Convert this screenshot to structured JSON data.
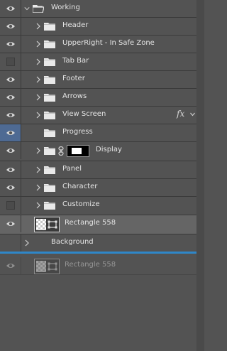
{
  "layers": [
    {
      "id": "working",
      "label": "Working",
      "visible": true,
      "kind": "group",
      "expanded": true,
      "indent": 0
    },
    {
      "id": "header",
      "label": "Header",
      "visible": true,
      "kind": "group",
      "indent": 1
    },
    {
      "id": "upperright",
      "label": "UpperRight - In Safe Zone",
      "visible": true,
      "kind": "group",
      "indent": 1
    },
    {
      "id": "tabbar",
      "label": "Tab Bar",
      "visible": false,
      "kind": "group",
      "indent": 1
    },
    {
      "id": "footer",
      "label": "Footer",
      "visible": true,
      "kind": "group",
      "indent": 1
    },
    {
      "id": "arrows",
      "label": "Arrows",
      "visible": true,
      "kind": "group",
      "indent": 1
    },
    {
      "id": "viewscreen",
      "label": "View Screen",
      "visible": true,
      "kind": "group",
      "indent": 1,
      "fx": "fx"
    },
    {
      "id": "progress",
      "label": "Progress",
      "visible": true,
      "kind": "group",
      "indent": 1,
      "nochevron": true,
      "highlight": true
    },
    {
      "id": "display",
      "label": "Display",
      "visible": true,
      "kind": "group-mask",
      "indent": 1
    },
    {
      "id": "panel",
      "label": "Panel",
      "visible": true,
      "kind": "group",
      "indent": 1
    },
    {
      "id": "character",
      "label": "Character",
      "visible": true,
      "kind": "group",
      "indent": 1
    },
    {
      "id": "customize",
      "label": "Customize",
      "visible": false,
      "kind": "group",
      "indent": 1
    },
    {
      "id": "rect558",
      "label": "Rectangle 558",
      "visible": true,
      "kind": "shape",
      "indent": 1,
      "selected": true
    },
    {
      "id": "background",
      "label": "Background",
      "visible": true,
      "kind": "group",
      "indent": 0,
      "noeye": true
    },
    {
      "id": "rect558ghost",
      "label": "Rectangle 558",
      "visible": true,
      "kind": "shape",
      "indent": 1,
      "ghost": true
    }
  ],
  "colors": {
    "panel": "#535353",
    "selected": "#656565",
    "highlight_eye": "#4e6a93",
    "drop_indicator": "#2f87c9"
  }
}
